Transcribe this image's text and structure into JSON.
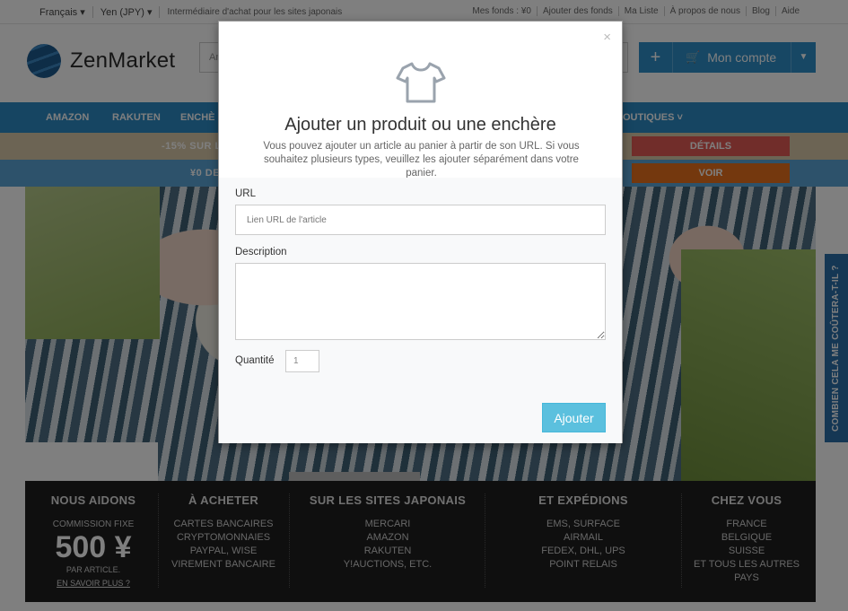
{
  "topbar": {
    "language": "Français",
    "currency": "Yen (JPY)",
    "tagline": "Intermédiaire d'achat pour les sites japonais",
    "links": [
      "Mes fonds : ¥0",
      "Ajouter des fonds",
      "Ma Liste",
      "À propos de nous",
      "Blog",
      "Aide"
    ]
  },
  "header": {
    "logo_text": "ZenMarket",
    "search_placeholder": "Ar",
    "account_label": "Mon compte"
  },
  "nav": {
    "items": [
      "AMAZON",
      "RAKUTEN",
      "ENCHÈ",
      "OUTIQUES ˅"
    ]
  },
  "banners": {
    "promo1_text": "-15% SUR L",
    "promo1_button": "DÉTAILS",
    "promo2_text": "¥0 DE",
    "promo2_button": "VOIR"
  },
  "footer_band": {
    "col1": {
      "heading": "NOUS AIDONS",
      "line1": "COMMISSION FIXE",
      "price": "500 ¥",
      "line2": "PAR ARTICLE.",
      "link": "EN SAVOIR PLUS ?"
    },
    "col2": {
      "heading": "À ACHETER",
      "items": [
        "CARTES BANCAIRES",
        "CRYPTOMONNAIES",
        "PAYPAL, WISE",
        "VIREMENT BANCAIRE"
      ]
    },
    "col3": {
      "heading": "SUR LES SITES JAPONAIS",
      "items": [
        "MERCARI",
        "AMAZON",
        "RAKUTEN",
        "Y!AUCTIONS, ETC."
      ]
    },
    "col4": {
      "heading": "ET EXPÉDIONS",
      "items": [
        "EMS, SURFACE",
        "AIRMAIL",
        "FEDEX, DHL, UPS",
        "POINT RELAIS"
      ]
    },
    "col5": {
      "heading": "CHEZ VOUS",
      "items": [
        "FRANCE",
        "BELGIQUE",
        "SUISSE",
        "ET TOUS LES AUTRES",
        "PAYS"
      ]
    }
  },
  "side_tab": "COMBIEN CELA ME COÛTERA-T-IL ?",
  "modal": {
    "close_label": "×",
    "icon": "tshirt-icon",
    "title": "Ajouter un produit ou une enchère",
    "description": "Vous pouvez ajouter un article au panier à partir de son URL. Si vous souhaitez plusieurs types, veuillez les ajouter séparément dans votre panier.",
    "url_label": "URL",
    "url_placeholder": "Lien URL de l'article",
    "description_label": "Description",
    "description_value": "",
    "quantity_label": "Quantité",
    "quantity_value": "1",
    "submit_label": "Ajouter"
  },
  "colors": {
    "accent": "#2d8ac4",
    "button": "#5bc0de",
    "promo_red": "#e35b55",
    "promo_orange": "#e8701c"
  }
}
